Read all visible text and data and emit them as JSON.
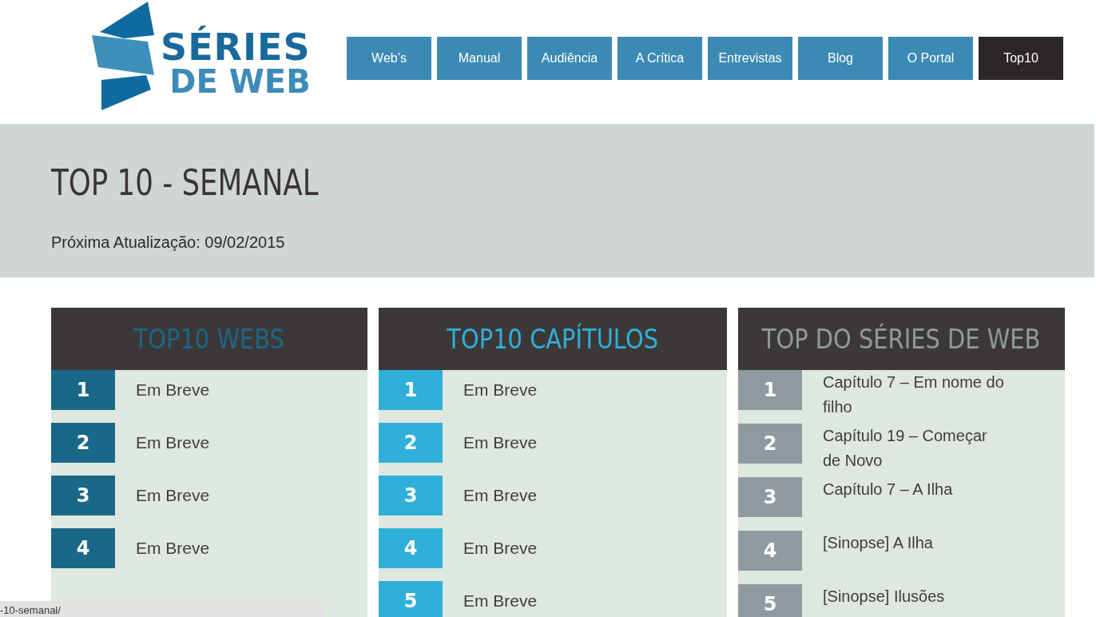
{
  "logo": {
    "line_1": "SÉRIES",
    "line_2": "DE WEB"
  },
  "nav": [
    {
      "label": "Web’s",
      "selected": false
    },
    {
      "label": "Manual",
      "selected": false
    },
    {
      "label": "Audiência",
      "selected": false
    },
    {
      "label": "A Crítica",
      "selected": false
    },
    {
      "label": "Entrevistas",
      "selected": false
    },
    {
      "label": "Blog",
      "selected": false
    },
    {
      "label": "O Portal",
      "selected": false
    },
    {
      "label": "Top10",
      "selected": true
    }
  ],
  "banner": {
    "title": "TOP 10 - SEMANAL",
    "subtitle": "Próxima Atualização: 09/02/2015"
  },
  "columns": [
    {
      "title": "TOP10 WEBS",
      "color": "#196887",
      "items": [
        {
          "rank": "1",
          "text": "Em Breve"
        },
        {
          "rank": "2",
          "text": "Em Breve"
        },
        {
          "rank": "3",
          "text": "Em Breve"
        },
        {
          "rank": "4",
          "text": "Em Breve"
        }
      ]
    },
    {
      "title": "TOP10 CAPÍTULOS",
      "color": "#2eb0d9",
      "items": [
        {
          "rank": "1",
          "text": "Em Breve"
        },
        {
          "rank": "2",
          "text": "Em Breve"
        },
        {
          "rank": "3",
          "text": "Em Breve"
        },
        {
          "rank": "4",
          "text": "Em Breve"
        },
        {
          "rank": "5",
          "text": "Em Breve"
        }
      ]
    },
    {
      "title": "TOP DO SÉRIES DE WEB",
      "color": "#8e9a9f",
      "items": [
        {
          "rank": "1",
          "text": "Capítulo 7 – Em nome do filho"
        },
        {
          "rank": "2",
          "text": "Capítulo 19 – Começar de Novo"
        },
        {
          "rank": "3",
          "text": "Capítulo 7 – A Ilha"
        },
        {
          "rank": "4",
          "text": "[Sinopse] A Ilha"
        },
        {
          "rank": "5",
          "text": "[Sinopse] Ilusões"
        }
      ]
    }
  ],
  "status_url": "-10-semanal/"
}
